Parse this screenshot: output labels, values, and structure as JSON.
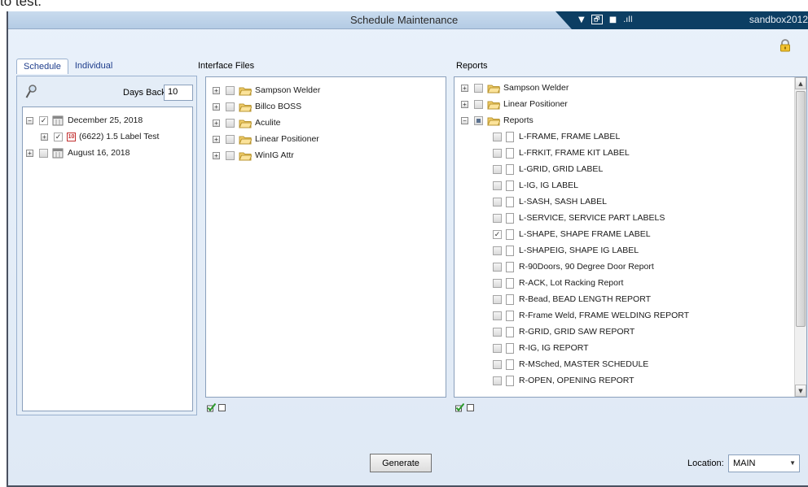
{
  "doc_text": "to test.",
  "window": {
    "title": "Schedule Maintenance",
    "user": "sandbox2012",
    "controls": [
      "▼",
      "🗗",
      "■",
      ".ıll"
    ]
  },
  "tabs": [
    {
      "label": "Schedule",
      "active": true
    },
    {
      "label": "Individual",
      "active": false
    }
  ],
  "schedule": {
    "days_back_label": "Days Back:",
    "days_back_value": "10",
    "tree": [
      {
        "label": "December 25, 2018",
        "level": 0,
        "expanded": true,
        "checked": true,
        "icon": "calendar-icon"
      },
      {
        "label": "(6622) 1.5 Label Test",
        "level": 1,
        "expanded": false,
        "checked": true,
        "icon": "label-icon"
      },
      {
        "label": "August 16, 2018",
        "level": 0,
        "expanded": false,
        "checked": false,
        "icon": "calendar-icon"
      }
    ]
  },
  "interface_files": {
    "label": "Interface Files",
    "items": [
      {
        "label": "Sampson Welder",
        "checked": false
      },
      {
        "label": "Billco BOSS",
        "checked": false
      },
      {
        "label": "Aculite",
        "checked": false
      },
      {
        "label": "Linear Positioner",
        "checked": false
      },
      {
        "label": "WinIG Attr",
        "checked": false
      }
    ]
  },
  "reports": {
    "label": "Reports",
    "folders": [
      {
        "label": "Sampson Welder",
        "expanded": false,
        "state": "unchecked"
      },
      {
        "label": "Linear Positioner",
        "expanded": false,
        "state": "unchecked"
      },
      {
        "label": "Reports",
        "expanded": true,
        "state": "partial"
      }
    ],
    "items": [
      {
        "label": "L-FRAME, FRAME LABEL",
        "checked": false
      },
      {
        "label": "L-FRKIT, FRAME KIT LABEL",
        "checked": false
      },
      {
        "label": "L-GRID, GRID LABEL",
        "checked": false
      },
      {
        "label": "L-IG, IG LABEL",
        "checked": false
      },
      {
        "label": "L-SASH, SASH LABEL",
        "checked": false
      },
      {
        "label": "L-SERVICE, SERVICE PART LABELS",
        "checked": false
      },
      {
        "label": "L-SHAPE, SHAPE FRAME LABEL",
        "checked": true
      },
      {
        "label": "L-SHAPEIG, SHAPE IG LABEL",
        "checked": false
      },
      {
        "label": "R-90Doors, 90 Degree Door Report",
        "checked": false
      },
      {
        "label": "R-ACK, Lot Racking Report",
        "checked": false
      },
      {
        "label": "R-Bead, BEAD LENGTH REPORT",
        "checked": false
      },
      {
        "label": "R-Frame Weld, FRAME WELDING REPORT",
        "checked": false
      },
      {
        "label": "R-GRID, GRID SAW  REPORT",
        "checked": false
      },
      {
        "label": "R-IG, IG REPORT",
        "checked": false
      },
      {
        "label": "R-MSched, MASTER SCHEDULE",
        "checked": false
      },
      {
        "label": "R-OPEN, OPENING REPORT",
        "checked": false
      }
    ]
  },
  "footer": {
    "generate_label": "Generate",
    "location_label": "Location:",
    "location_value": "MAIN"
  }
}
